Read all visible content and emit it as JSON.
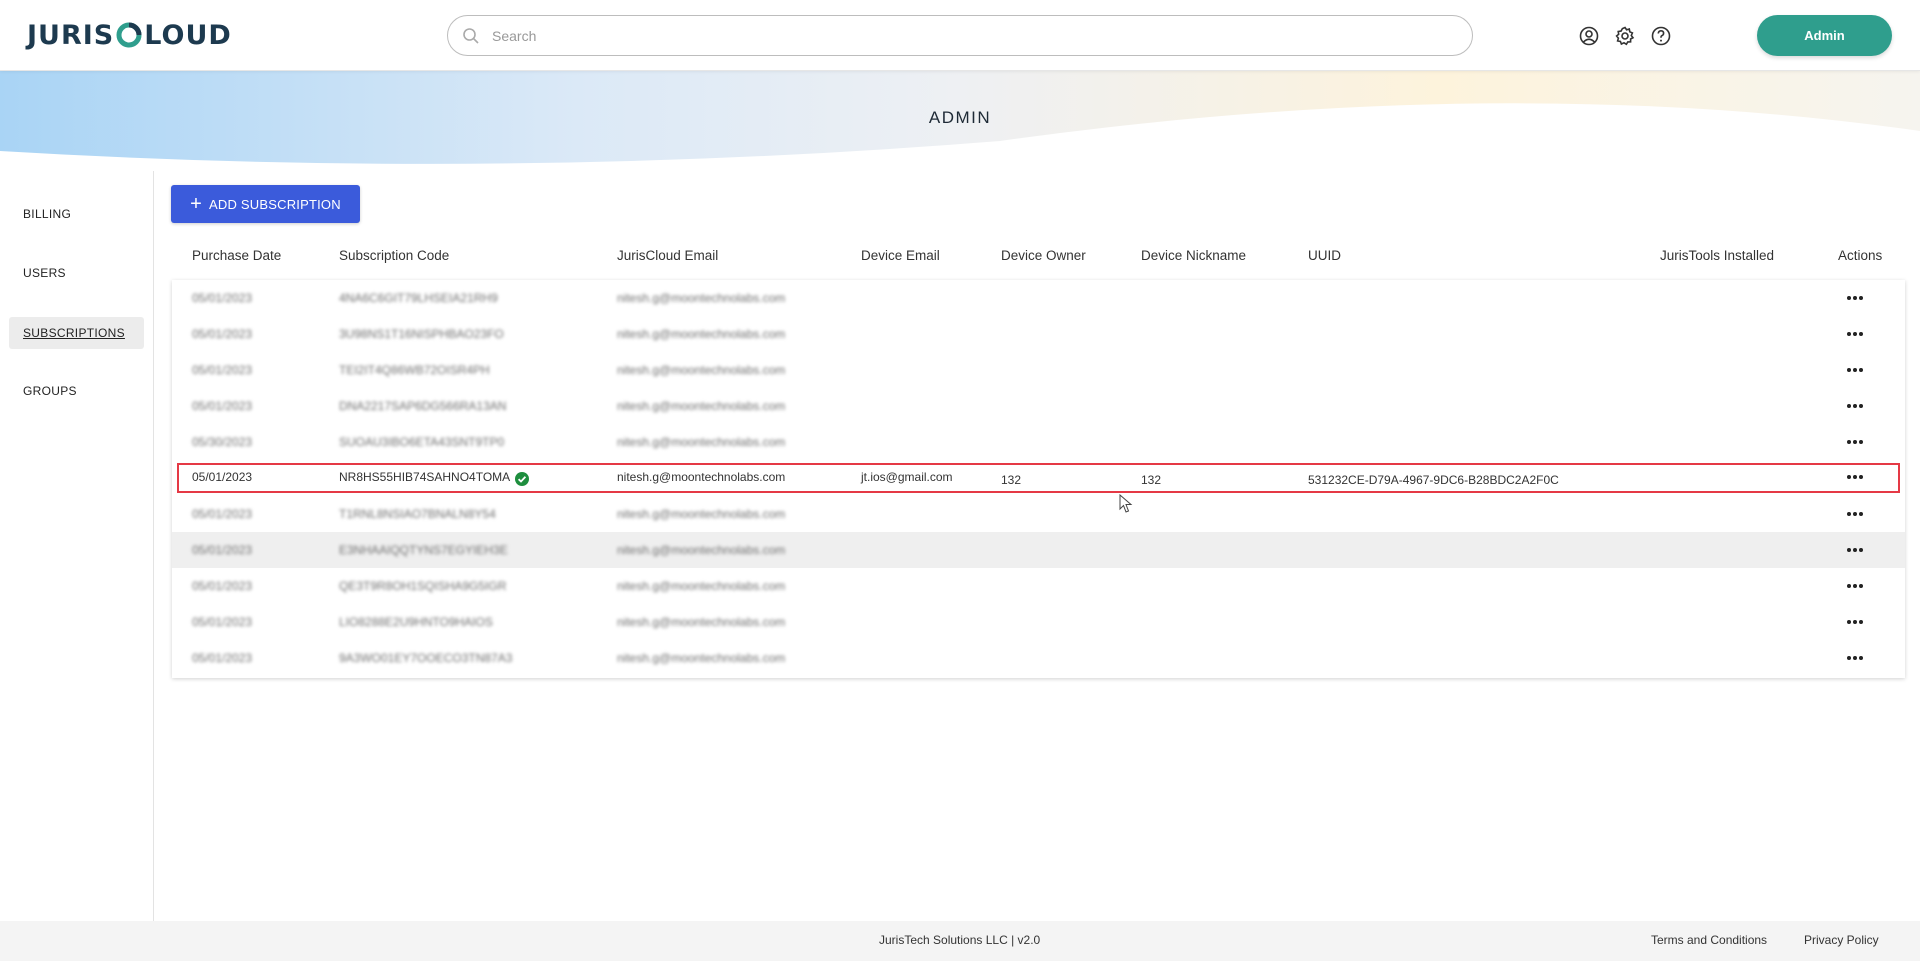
{
  "header": {
    "logo_text": "JURISCLOUD",
    "search_placeholder": "Search",
    "admin_label": "Admin",
    "icons": [
      "account-icon",
      "gear-icon",
      "help-icon"
    ]
  },
  "banner": {
    "title": "ADMIN"
  },
  "sidebar": {
    "items": [
      {
        "label": "BILLING",
        "active": false
      },
      {
        "label": "USERS",
        "active": false
      },
      {
        "label": "SUBSCRIPTIONS",
        "active": true
      },
      {
        "label": "GROUPS",
        "active": false
      }
    ]
  },
  "toolbar": {
    "add_label": "ADD SUBSCRIPTION"
  },
  "table": {
    "columns": [
      "Purchase Date",
      "Subscription Code",
      "JurisCloud Email",
      "Device Email",
      "Device Owner",
      "Device Nickname",
      "UUID",
      "JurisTools Installed",
      "Actions"
    ],
    "rows": [
      {
        "date": "05/01/2023",
        "code": "4NA6C6GIT79LHSEIA21RH9",
        "email": "nitesh.g@moontechnolabs.com",
        "device_email": "",
        "owner": "",
        "nickname": "",
        "uuid": "",
        "blurred": true
      },
      {
        "date": "05/01/2023",
        "code": "3U98NS1T16NISPHBAO23FO",
        "email": "nitesh.g@moontechnolabs.com",
        "device_email": "",
        "owner": "",
        "nickname": "",
        "uuid": "",
        "blurred": true
      },
      {
        "date": "05/01/2023",
        "code": "TEI2IT4Q86WB72OISR4PH",
        "email": "nitesh.g@moontechnolabs.com",
        "device_email": "",
        "owner": "",
        "nickname": "",
        "uuid": "",
        "blurred": true
      },
      {
        "date": "05/01/2023",
        "code": "DNA2217SAP6DG566RA13AN",
        "email": "nitesh.g@moontechnolabs.com",
        "device_email": "",
        "owner": "",
        "nickname": "",
        "uuid": "",
        "blurred": true
      },
      {
        "date": "05/30/2023",
        "code": "SUOAU3IBO6ETA43SNT9TP0",
        "email": "nitesh.g@moontechnolabs.com",
        "device_email": "",
        "owner": "",
        "nickname": "",
        "uuid": "",
        "blurred": true
      },
      {
        "date": "05/01/2023",
        "code": "NR8HS55HIB74SAHNO4TOMA",
        "email": "nitesh.g@moontechnolabs.com",
        "device_email": "jt.ios@gmail.com",
        "owner": "132",
        "nickname": "132",
        "uuid": "531232CE-D79A-4967-9DC6-B28BDC2A2F0C",
        "blurred": false,
        "verified": true
      },
      {
        "date": "05/01/2023",
        "code": "T1RNL8NSIAO7BNALN8Y54",
        "email": "nitesh.g@moontechnolabs.com",
        "device_email": "",
        "owner": "",
        "nickname": "",
        "uuid": "",
        "blurred": true
      },
      {
        "date": "05/01/2023",
        "code": "E3NHAAIQQTYNS7EGYIEH3E",
        "email": "nitesh.g@moontechnolabs.com",
        "device_email": "",
        "owner": "",
        "nickname": "",
        "uuid": "",
        "blurred": true,
        "hover": true
      },
      {
        "date": "05/01/2023",
        "code": "QE3T9R8OH1SQISHA9G5IGR",
        "email": "nitesh.g@moontechnolabs.com",
        "device_email": "",
        "owner": "",
        "nickname": "",
        "uuid": "",
        "blurred": true
      },
      {
        "date": "05/01/2023",
        "code": "LIO8288E2U9HNTO9HAIOS",
        "email": "nitesh.g@moontechnolabs.com",
        "device_email": "",
        "owner": "",
        "nickname": "",
        "uuid": "",
        "blurred": true
      },
      {
        "date": "05/01/2023",
        "code": "9A3WO01EY7OOECO3TN87A3",
        "email": "nitesh.g@moontechnolabs.com",
        "device_email": "",
        "owner": "",
        "nickname": "",
        "uuid": "",
        "blurred": true
      }
    ]
  },
  "footer": {
    "company": "JurisTech Solutions LLC | v2.0",
    "terms": "Terms and Conditions",
    "privacy": "Privacy Policy"
  },
  "colors": {
    "accent_teal": "#2f9e8d",
    "primary_blue": "#3b5bdb",
    "highlight_red": "#e53945",
    "verified_green": "#1e8e3e"
  }
}
